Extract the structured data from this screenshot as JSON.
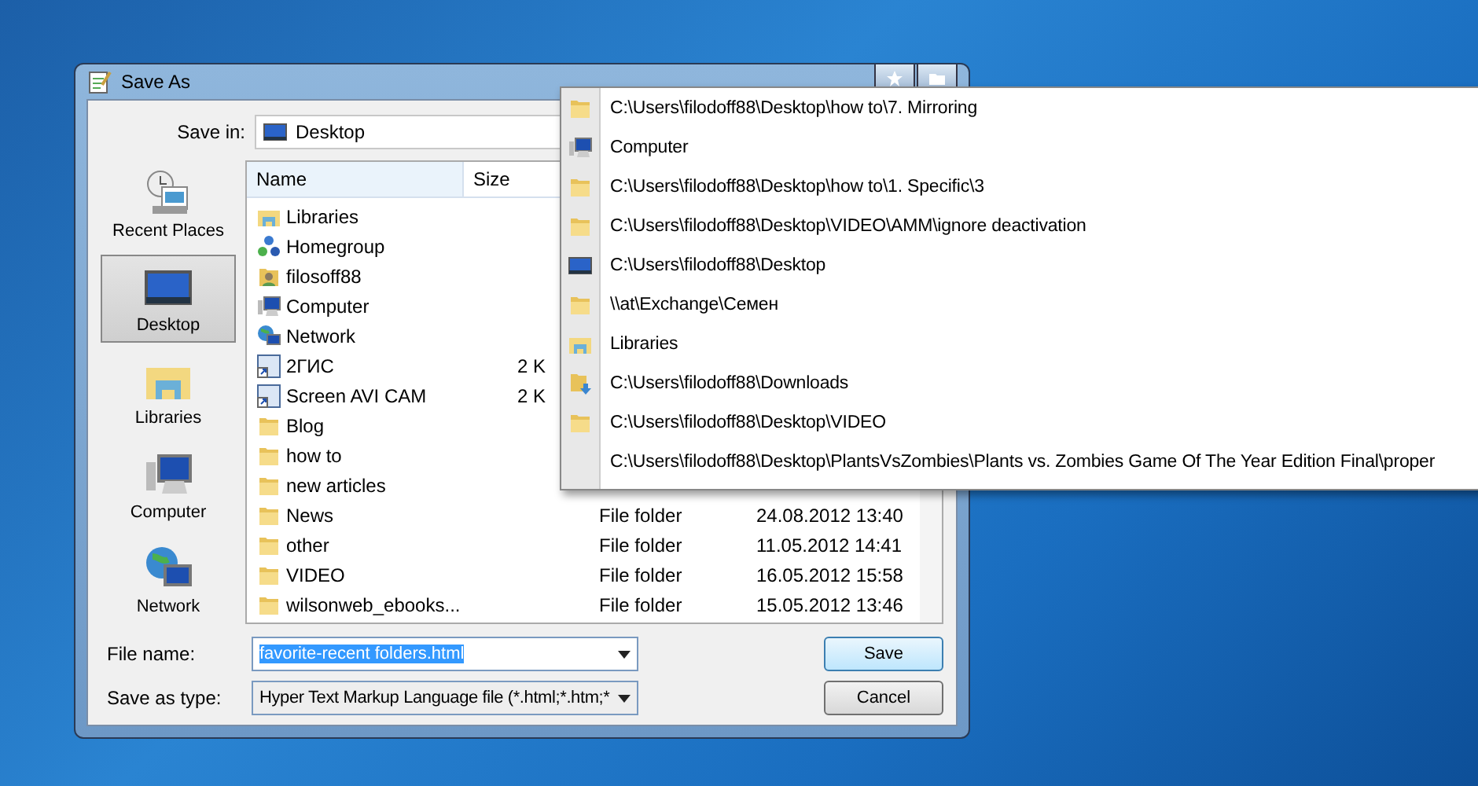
{
  "window": {
    "title": "Save As"
  },
  "save_in": {
    "label": "Save in:",
    "value": "Desktop"
  },
  "places": [
    {
      "label": "Recent Places",
      "kind": "recent",
      "selected": false
    },
    {
      "label": "Desktop",
      "kind": "desktop",
      "selected": true
    },
    {
      "label": "Libraries",
      "kind": "libraries",
      "selected": false
    },
    {
      "label": "Computer",
      "kind": "computer",
      "selected": false
    },
    {
      "label": "Network",
      "kind": "network",
      "selected": false
    }
  ],
  "table": {
    "columns": [
      "Name",
      "Size"
    ],
    "rows": [
      {
        "name": "Libraries",
        "kind": "libraries"
      },
      {
        "name": "Homegroup",
        "kind": "homegroup"
      },
      {
        "name": "filosoff88",
        "kind": "user"
      },
      {
        "name": "Computer",
        "kind": "computer"
      },
      {
        "name": "Network",
        "kind": "network"
      },
      {
        "name": "2ГИС",
        "kind": "shortcut",
        "size": "2 K"
      },
      {
        "name": "Screen AVI CAM",
        "kind": "shortcut",
        "size": "2 K"
      },
      {
        "name": "Blog",
        "kind": "folder"
      },
      {
        "name": "how to",
        "kind": "folder"
      },
      {
        "name": "new articles",
        "kind": "folder"
      },
      {
        "name": "News",
        "kind": "folder",
        "type": "File folder",
        "date": "24.08.2012 13:40"
      },
      {
        "name": "other",
        "kind": "folder",
        "type": "File folder",
        "date": "11.05.2012 14:41"
      },
      {
        "name": "VIDEO",
        "kind": "folder",
        "type": "File folder",
        "date": "16.05.2012 15:58"
      },
      {
        "name": "wilsonweb_ebooks...",
        "kind": "folder",
        "type": "File folder",
        "date": "15.05.2012 13:46"
      }
    ]
  },
  "file_name": {
    "label": "File name:",
    "value": "favorite-recent folders.html"
  },
  "save_as_type": {
    "label": "Save as type:",
    "value": "Hyper Text Markup Language file (*.html;*.htm;*"
  },
  "buttons": [
    "Save",
    "Cancel"
  ],
  "recent_folders": [
    {
      "path": "C:\\Users\\filodoff88\\Desktop\\how to\\7. Mirroring",
      "kind": "folder"
    },
    {
      "path": "Computer",
      "kind": "computer"
    },
    {
      "path": "C:\\Users\\filodoff88\\Desktop\\how to\\1. Specific\\3",
      "kind": "folder"
    },
    {
      "path": "C:\\Users\\filodoff88\\Desktop\\VIDEO\\AMM\\ignore deactivation",
      "kind": "folder"
    },
    {
      "path": "C:\\Users\\filodoff88\\Desktop",
      "kind": "desktop"
    },
    {
      "path": "\\\\at\\Exchange\\Семен",
      "kind": "folder"
    },
    {
      "path": "Libraries",
      "kind": "libraries"
    },
    {
      "path": "C:\\Users\\filodoff88\\Downloads",
      "kind": "downloads"
    },
    {
      "path": "C:\\Users\\filodoff88\\Desktop\\VIDEO",
      "kind": "folder"
    },
    {
      "path": "C:\\Users\\filodoff88\\Desktop\\PlantsVsZombies\\Plants vs. Zombies Game Of The Year Edition Final\\proper",
      "kind": "none"
    }
  ]
}
